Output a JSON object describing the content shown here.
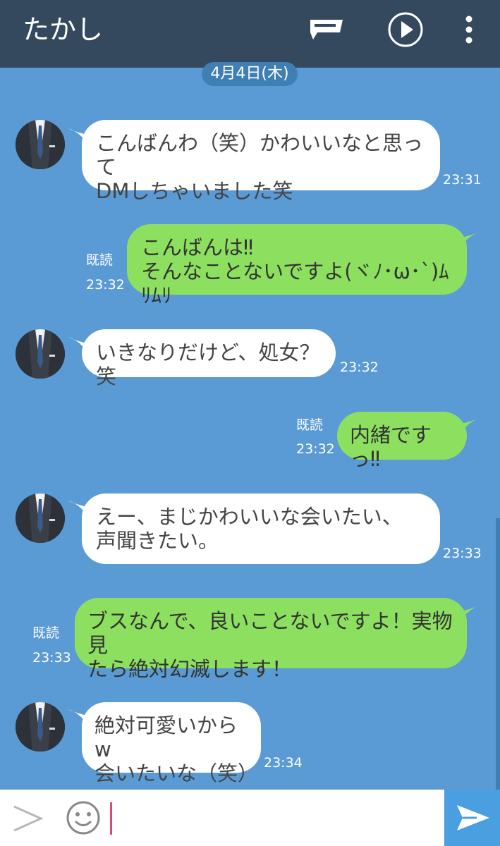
{
  "header": {
    "title": "たかし",
    "icons": [
      "message-icon",
      "play-circle-icon",
      "more-vertical-icon"
    ]
  },
  "date_label": "4月4日(木)",
  "messages": [
    {
      "side": "in",
      "text": "こんばんわ（笑）かわいいなと思って\nDMしちゃいました笑",
      "time": "23:31"
    },
    {
      "side": "out",
      "text": "こんばんは‼\nそんなことないですよ(ヾﾉ･ω･`)ﾑﾘﾑﾘ",
      "time": "23:32",
      "read": "既読"
    },
    {
      "side": "in",
      "text": "いきなりだけど、処女？笑",
      "time": "23:32"
    },
    {
      "side": "out",
      "text": "内緒ですっ‼",
      "time": "23:32",
      "read": "既読"
    },
    {
      "side": "in",
      "text": "えー、まじかわいいな会いたい、\n声聞きたい。",
      "time": "23:33"
    },
    {
      "side": "out",
      "text": "ブスなんで、良いことないですよ！実物見\nたら絶対幻滅します！",
      "time": "23:33",
      "read": "既読"
    },
    {
      "side": "in",
      "text": "絶対可愛いからw\n会いたいな（笑）",
      "time": "23:34"
    }
  ],
  "input_bar": {
    "icons": [
      "expand-chevron-icon",
      "emoji-icon",
      "send-icon"
    ],
    "value": ""
  },
  "colors": {
    "header_bg": "#34495e",
    "chat_bg": "#5b9bd5",
    "incoming_bubble": "#ffffff",
    "outgoing_bubble": "#8de05f",
    "send_button": "#4a9fe0",
    "cursor": "#e0487a"
  }
}
